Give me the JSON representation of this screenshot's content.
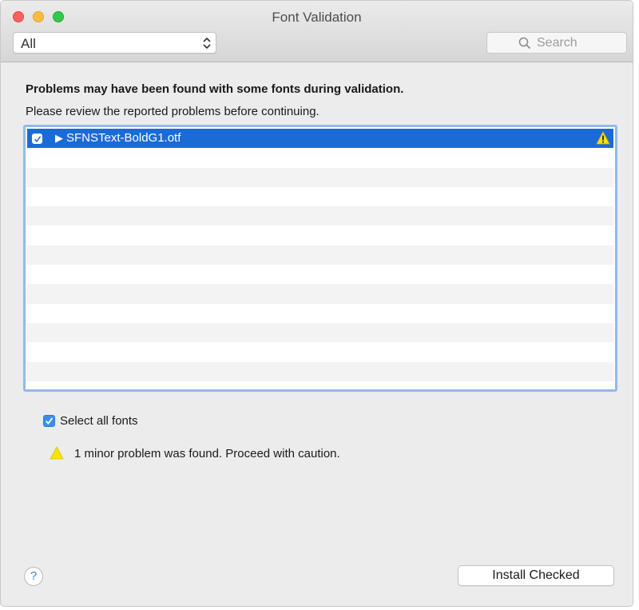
{
  "window": {
    "title": "Font Validation"
  },
  "toolbar": {
    "filter_selected": "All",
    "search_placeholder": "Search"
  },
  "main": {
    "heading": "Problems may have been found with some fonts during validation.",
    "subtext": "Please review the reported problems before continuing."
  },
  "font_list": {
    "items": [
      {
        "checked": true,
        "expanded": false,
        "filename": "SFNSText-BoldG1.otf",
        "status_icon": "warning-icon",
        "selected": true
      }
    ]
  },
  "select_all": {
    "label": "Select all fonts",
    "checked": true
  },
  "status": {
    "icon": "warning-icon",
    "message": "1 minor problem was found. Proceed with caution."
  },
  "footer": {
    "help_label": "?",
    "install_label": "Install Checked"
  },
  "colors": {
    "selection": "#1b6bd7",
    "focus_ring": "#93b9ea",
    "checkbox": "#3b8df2",
    "warning": "#f6e300"
  }
}
